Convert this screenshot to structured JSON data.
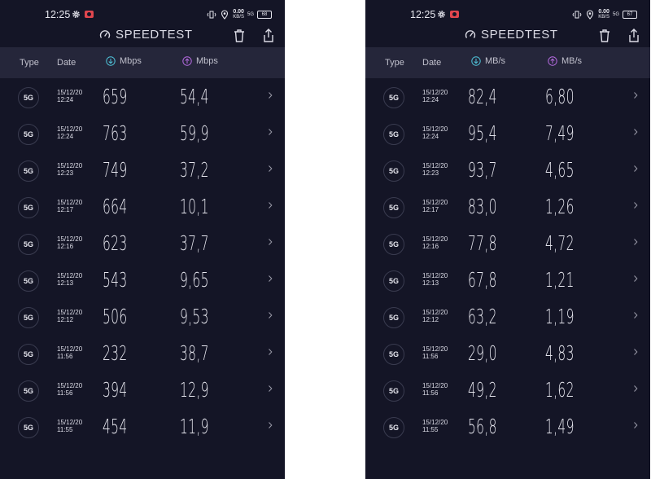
{
  "screens": [
    {
      "status": {
        "time": "12:25",
        "net_speed_value": "0.00",
        "net_speed_unit": "KB/S",
        "sim_label": "5G",
        "battery": "68"
      },
      "app_title": "SPEEDTEST",
      "header": {
        "type": "Type",
        "date": "Date",
        "download_unit": "Mbps",
        "upload_unit": "Mbps"
      },
      "rows": [
        {
          "type": "5G",
          "date": "15/12/20",
          "time": "12:24",
          "download": "659",
          "upload": "54,4"
        },
        {
          "type": "5G",
          "date": "15/12/20",
          "time": "12:24",
          "download": "763",
          "upload": "59,9"
        },
        {
          "type": "5G",
          "date": "15/12/20",
          "time": "12:23",
          "download": "749",
          "upload": "37,2"
        },
        {
          "type": "5G",
          "date": "15/12/20",
          "time": "12:17",
          "download": "664",
          "upload": "10,1"
        },
        {
          "type": "5G",
          "date": "15/12/20",
          "time": "12:16",
          "download": "623",
          "upload": "37,7"
        },
        {
          "type": "5G",
          "date": "15/12/20",
          "time": "12:13",
          "download": "543",
          "upload": "9,65"
        },
        {
          "type": "5G",
          "date": "15/12/20",
          "time": "12:12",
          "download": "506",
          "upload": "9,53"
        },
        {
          "type": "5G",
          "date": "15/12/20",
          "time": "11:56",
          "download": "232",
          "upload": "38,7"
        },
        {
          "type": "5G",
          "date": "15/12/20",
          "time": "11:56",
          "download": "394",
          "upload": "12,9"
        },
        {
          "type": "5G",
          "date": "15/12/20",
          "time": "11:55",
          "download": "454",
          "upload": "11,9"
        }
      ]
    },
    {
      "status": {
        "time": "12:25",
        "net_speed_value": "0.00",
        "net_speed_unit": "KB/S",
        "sim_label": "5G",
        "battery": "67"
      },
      "app_title": "SPEEDTEST",
      "header": {
        "type": "Type",
        "date": "Date",
        "download_unit": "MB/s",
        "upload_unit": "MB/s"
      },
      "rows": [
        {
          "type": "5G",
          "date": "15/12/20",
          "time": "12:24",
          "download": "82,4",
          "upload": "6,80"
        },
        {
          "type": "5G",
          "date": "15/12/20",
          "time": "12:24",
          "download": "95,4",
          "upload": "7,49"
        },
        {
          "type": "5G",
          "date": "15/12/20",
          "time": "12:23",
          "download": "93,7",
          "upload": "4,65"
        },
        {
          "type": "5G",
          "date": "15/12/20",
          "time": "12:17",
          "download": "83,0",
          "upload": "1,26"
        },
        {
          "type": "5G",
          "date": "15/12/20",
          "time": "12:16",
          "download": "77,8",
          "upload": "4,72"
        },
        {
          "type": "5G",
          "date": "15/12/20",
          "time": "12:13",
          "download": "67,8",
          "upload": "1,21"
        },
        {
          "type": "5G",
          "date": "15/12/20",
          "time": "12:12",
          "download": "63,2",
          "upload": "1,19"
        },
        {
          "type": "5G",
          "date": "15/12/20",
          "time": "11:56",
          "download": "29,0",
          "upload": "4,83"
        },
        {
          "type": "5G",
          "date": "15/12/20",
          "time": "11:56",
          "download": "49,2",
          "upload": "1,62"
        },
        {
          "type": "5G",
          "date": "15/12/20",
          "time": "11:55",
          "download": "56,8",
          "upload": "1,49"
        }
      ]
    }
  ],
  "icons": {
    "gear": "gear-icon",
    "record": "screen-record-icon",
    "vibrate": "vibrate-icon",
    "location": "location-icon",
    "gauge": "speedometer-icon",
    "trash": "trash-icon",
    "share": "share-icon",
    "download": "download-arrow-icon",
    "upload": "upload-arrow-icon",
    "chevron": "chevron-right-icon"
  },
  "colors": {
    "background": "#141526",
    "header": "#25263a",
    "download_accent": "#4fc3d9",
    "upload_accent": "#b56be0",
    "record": "#e0464e"
  }
}
